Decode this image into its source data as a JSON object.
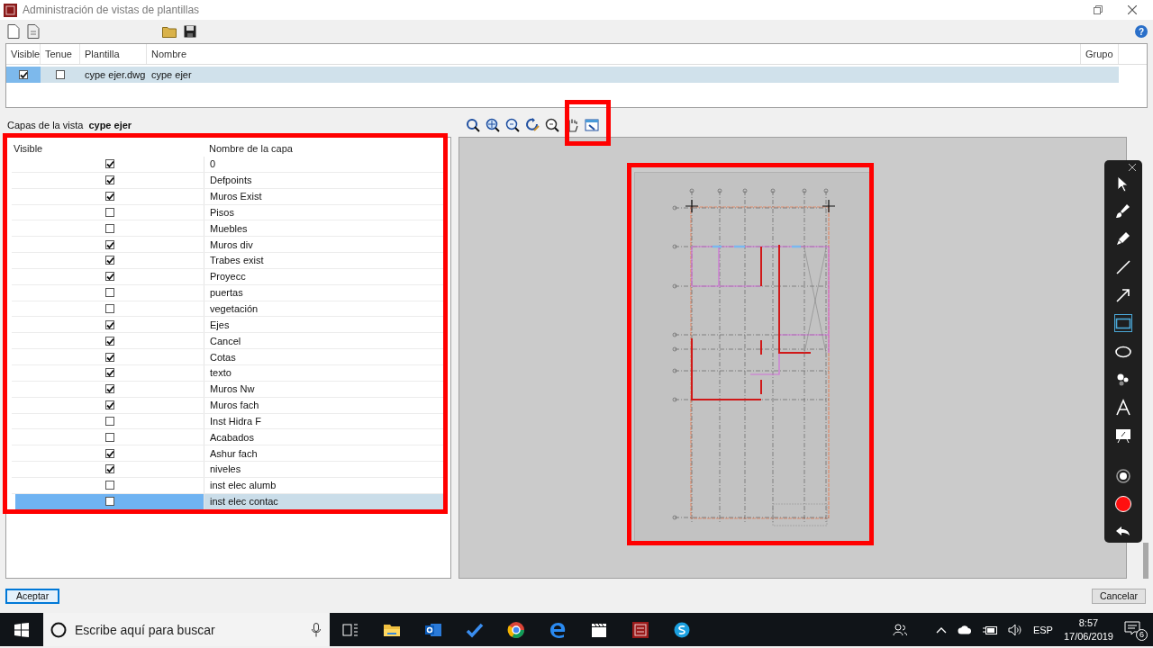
{
  "window": {
    "title": "Administración de vistas de plantillas",
    "help": "?"
  },
  "templates": {
    "columns": [
      "Visible",
      "Tenue",
      "Plantilla",
      "Nombre",
      "Grupo"
    ],
    "rows": [
      {
        "visible": true,
        "tenue": false,
        "plantilla": "cype ejer.dwg",
        "nombre": "cype ejer",
        "selected": true
      }
    ]
  },
  "view_layers": {
    "label": "Capas de la vista",
    "view_name": "cype ejer",
    "columns": [
      "Visible",
      "Nombre de la capa"
    ],
    "rows": [
      {
        "name": "0",
        "visible": true,
        "selected": false
      },
      {
        "name": "Defpoints",
        "visible": true,
        "selected": false
      },
      {
        "name": "Muros Exist",
        "visible": true,
        "selected": false
      },
      {
        "name": "Pisos",
        "visible": false,
        "selected": false
      },
      {
        "name": "Muebles",
        "visible": false,
        "selected": false
      },
      {
        "name": "Muros div",
        "visible": true,
        "selected": false
      },
      {
        "name": "Trabes exist",
        "visible": true,
        "selected": false
      },
      {
        "name": "Proyecc",
        "visible": true,
        "selected": false
      },
      {
        "name": "puertas",
        "visible": false,
        "selected": false
      },
      {
        "name": "vegetación",
        "visible": false,
        "selected": false
      },
      {
        "name": "Ejes",
        "visible": true,
        "selected": false
      },
      {
        "name": "Cancel",
        "visible": true,
        "selected": false
      },
      {
        "name": "Cotas",
        "visible": true,
        "selected": false
      },
      {
        "name": "texto",
        "visible": true,
        "selected": false
      },
      {
        "name": "Muros Nw",
        "visible": true,
        "selected": false
      },
      {
        "name": "Muros fach",
        "visible": true,
        "selected": false
      },
      {
        "name": "Inst Hidra F",
        "visible": false,
        "selected": false
      },
      {
        "name": "Acabados",
        "visible": false,
        "selected": false
      },
      {
        "name": "Ashur fach",
        "visible": true,
        "selected": false
      },
      {
        "name": "niveles",
        "visible": true,
        "selected": false
      },
      {
        "name": "inst elec alumb",
        "visible": false,
        "selected": false
      },
      {
        "name": "inst elec contac",
        "visible": false,
        "selected": true
      }
    ]
  },
  "annotation_tools": [
    {
      "kind": "pointer",
      "selected": false
    },
    {
      "kind": "brush",
      "selected": false
    },
    {
      "kind": "highlighter",
      "selected": false
    },
    {
      "kind": "line",
      "selected": false
    },
    {
      "kind": "arrow",
      "selected": false
    },
    {
      "kind": "rectangle",
      "selected": true
    },
    {
      "kind": "ellipse",
      "selected": false
    },
    {
      "kind": "numbers",
      "selected": false
    },
    {
      "kind": "text",
      "selected": false
    },
    {
      "kind": "whiteboard",
      "selected": false
    },
    {
      "kind": "record",
      "selected": false
    },
    {
      "kind": "color",
      "selected": false
    },
    {
      "kind": "undo",
      "selected": false
    }
  ],
  "buttons": [
    {
      "label": "Aceptar",
      "kind": "default"
    },
    {
      "label": "Cancelar",
      "kind": "normal"
    }
  ],
  "taskbar": {
    "search_placeholder": "Escribe aquí para buscar",
    "language": "ESP",
    "time": "8:57",
    "date": "17/06/2019",
    "notifications": "6"
  }
}
